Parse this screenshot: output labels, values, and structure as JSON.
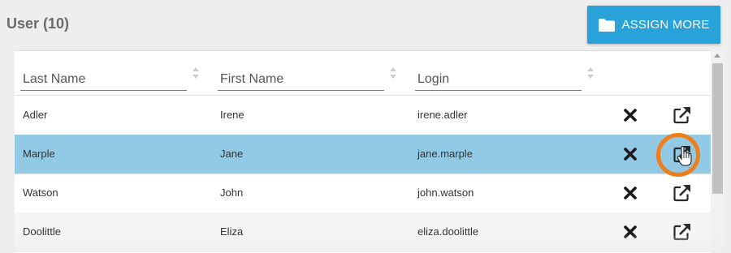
{
  "header": {
    "title": "User (10)",
    "assign_button_label": "ASSIGN MORE",
    "assign_button_icon": "folder-icon"
  },
  "table": {
    "columns": [
      {
        "label": "Last Name",
        "sort_icon": "sort-icon"
      },
      {
        "label": "First Name",
        "sort_icon": "sort-icon"
      },
      {
        "label": "Login",
        "sort_icon": "sort-icon"
      }
    ],
    "rows": [
      {
        "last_name": "Adler",
        "first_name": "Irene",
        "login": "irene.adler",
        "selected": false
      },
      {
        "last_name": "Marple",
        "first_name": "Jane",
        "login": "jane.marple",
        "selected": true
      },
      {
        "last_name": "Watson",
        "first_name": "John",
        "login": "john.watson",
        "selected": false
      },
      {
        "last_name": "Doolittle",
        "first_name": "Eliza",
        "login": "eliza.doolittle",
        "selected": false
      }
    ],
    "row_actions": [
      "delete-icon",
      "open-external-icon"
    ]
  },
  "colors": {
    "accent": "#29a1d9",
    "selected_row": "#92c9e5",
    "highlight": "#ee7d1c"
  }
}
